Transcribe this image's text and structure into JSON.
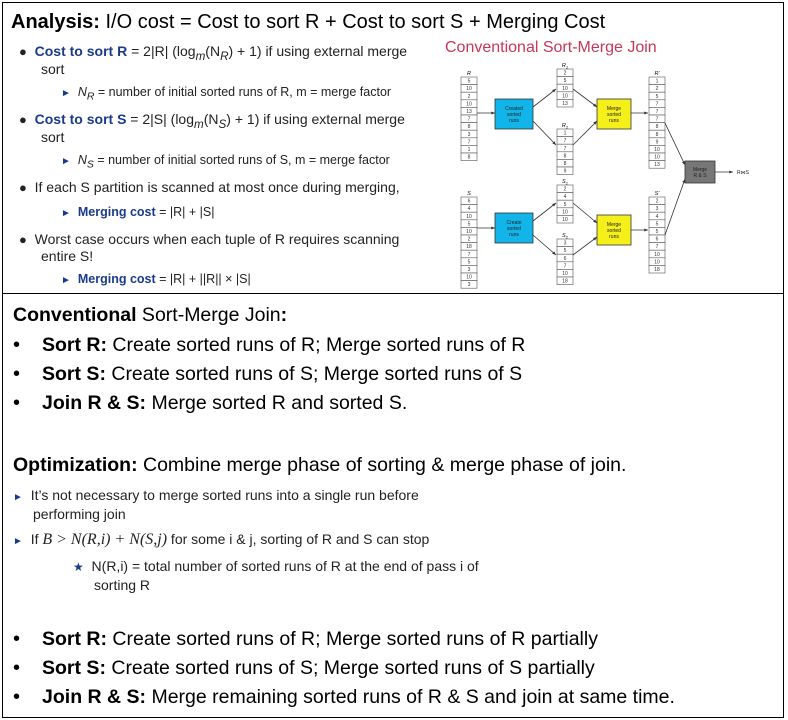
{
  "top": {
    "analysis_label": "Analysis:",
    "analysis_text": " I/O cost = Cost to sort R + Cost to sort S + Merging Cost",
    "items": [
      {
        "label": "Cost to sort R",
        "formula": " = 2|R| (log",
        "sub": "m",
        "formula2": "(N",
        "sub2": "R",
        "formula3": ") + 1) if using external merge",
        "cont": "sort"
      },
      {
        "label": "Cost to sort S",
        "formula": " = 2|S| (log",
        "sub": "m",
        "formula2": "(N",
        "sub2": "S",
        "formula3": ") + 1) if using external merge",
        "cont": "sort"
      }
    ],
    "nr_note": "N",
    "nr_sub": "R",
    "nr_rest": " = number of initial sorted runs of R,   m = merge factor",
    "ns_sub": "S",
    "ns_rest": " = number of initial sorted runs of S,   m = merge factor",
    "scan_once": "If each S partition is scanned at most once during merging,",
    "merge_cost1_label": "Merging cost",
    "merge_cost1": " = |R| + |S|",
    "worst1": "Worst case occurs when each tuple of R requires scanning",
    "worst2": "entire S!",
    "merge_cost2_label": "Merging cost",
    "merge_cost2": " = |R| + ||R|| × |S|",
    "diagram_title": "Conventional Sort-Merge Join",
    "diagram": {
      "R_label": "R",
      "R_values": [
        "5",
        "10",
        "2",
        "10",
        "13",
        "7",
        "8",
        "3",
        "7",
        "1",
        "8"
      ],
      "R1_label": "R",
      "R1_sub": "1",
      "R1_values": [
        "2",
        "5",
        "10",
        "10",
        "13"
      ],
      "R2_label": "R",
      "R2_sub": "2",
      "R2_values": [
        "1",
        "7",
        "7",
        "8",
        "8",
        "9"
      ],
      "Rp_label": "R'",
      "Rp_values": [
        "1",
        "2",
        "5",
        "7",
        "7",
        "7",
        "8",
        "8",
        "9",
        "10",
        "10",
        "13"
      ],
      "S_label": "S",
      "S_values": [
        "6",
        "4",
        "10",
        "5",
        "10",
        "2",
        "18",
        "7",
        "5",
        "3",
        "10",
        "3"
      ],
      "S1_label": "S",
      "S1_sub": "1",
      "S1_values": [
        "2",
        "4",
        "5",
        "10",
        "10"
      ],
      "S2_label": "S",
      "S2_sub": "2",
      "S2_values": [
        "3",
        "5",
        "6",
        "7",
        "10",
        "18"
      ],
      "Sp_label": "S'",
      "Sp_values": [
        "2",
        "3",
        "4",
        "5",
        "5",
        "6",
        "7",
        "10",
        "10",
        "18"
      ],
      "create_runs": [
        "Created",
        "sorted",
        "runs"
      ],
      "create_runs2": [
        "Create",
        "sorted",
        "runs"
      ],
      "merge_runs": [
        "Merge",
        "sorted",
        "runs"
      ],
      "merge_rs": [
        "Merge",
        "R & S"
      ],
      "output": "R⋈S"
    }
  },
  "bottom": {
    "conv_bold": "Conventional",
    "conv_rest": " Sort-Merge Join",
    "conv_colon": ":",
    "conv_items": [
      {
        "bold": "Sort R:",
        "text": " Create sorted runs of R; Merge sorted runs of R"
      },
      {
        "bold": "Sort S:",
        "text": " Create sorted runs of S; Merge sorted runs of S"
      },
      {
        "bold": "Join R & S:",
        "text": " Merge sorted R and sorted S."
      }
    ],
    "opt_bold": "Optimization:",
    "opt_text": " Combine merge phase of sorting & merge phase of join.",
    "notes": [
      {
        "line1": "It’s not necessary to merge sorted runs into a single run before",
        "line2": "performing join"
      },
      {
        "line1a": "If ",
        "line1b": "B > N(R,i) + N(S,j)",
        "line1c": " for some i & j, sorting of R and S can stop"
      }
    ],
    "subnote1": "N(R,i) = total number of sorted runs of R at the end of pass i of",
    "subnote2": "sorting R",
    "opt_items": [
      {
        "bold": "Sort R:",
        "text": " Create sorted runs of R; Merge sorted runs of R partially"
      },
      {
        "bold": "Sort S:",
        "text": " Create sorted runs of S; Merge sorted runs of S partially"
      },
      {
        "bold": "Join R & S:",
        "text": " Merge remaining sorted runs of R & S and join at same time."
      }
    ]
  }
}
